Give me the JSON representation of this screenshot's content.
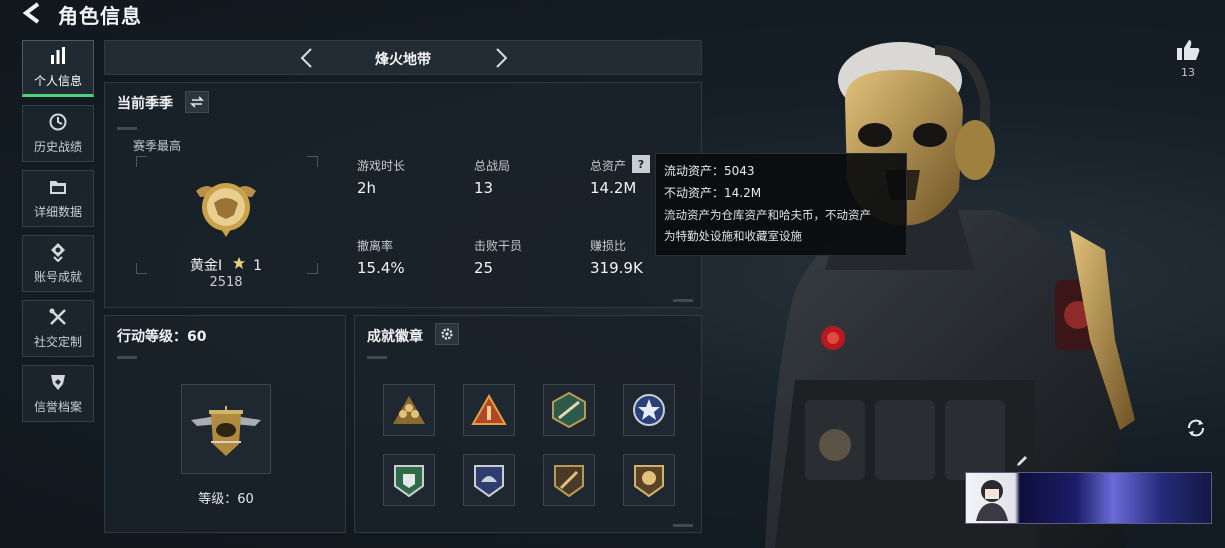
{
  "header": {
    "title": "角色信息"
  },
  "sidebar": {
    "items": [
      {
        "label": "个人信息",
        "icon": "bar-chart-icon",
        "active": true
      },
      {
        "label": "历史战绩",
        "icon": "clock-icon"
      },
      {
        "label": "详细数据",
        "icon": "folder-icon"
      },
      {
        "label": "账号成就",
        "icon": "diamond-medal-icon"
      },
      {
        "label": "社交定制",
        "icon": "wrench-cross-icon"
      },
      {
        "label": "信誉档案",
        "icon": "shield-heart-icon"
      }
    ]
  },
  "season_bar": {
    "name": "烽火地带"
  },
  "current_season": {
    "title": "当前季季",
    "highest_label": "赛季最高",
    "rank_name": "黄金Ⅰ",
    "rank_stars": "1",
    "rank_points": "2518",
    "stats": [
      {
        "label": "游戏时长",
        "value": "2h"
      },
      {
        "label": "总战局",
        "value": "13"
      },
      {
        "label": "总资产",
        "value": "14.2M"
      },
      {
        "label": "撤离率",
        "value": "15.4%"
      },
      {
        "label": "击败干员",
        "value": "25"
      },
      {
        "label": "赚损比",
        "value": "319.9K"
      }
    ]
  },
  "tooltip": {
    "liquid": "流动资产：5043",
    "fixed": "不动资产：14.2M",
    "desc_line1": "流动资产为仓库资产和哈夫币，不动资产",
    "desc_line2": "为特勤处设施和收藏室设施"
  },
  "action_level": {
    "title": "行动等级：60",
    "level_text": "等级：60"
  },
  "achievements": {
    "title": "成就徽章",
    "badges": [
      "squad-badge-icon",
      "rank-one-badge-icon",
      "rifle-badge-icon",
      "star-wings-badge-icon",
      "shield-badge-icon",
      "helmet-badge-icon",
      "knife-badge-icon",
      "beast-badge-icon"
    ]
  },
  "like": {
    "count": "13"
  },
  "colors": {
    "accent_green": "#4fd07a",
    "gold": "#c9a24a"
  }
}
